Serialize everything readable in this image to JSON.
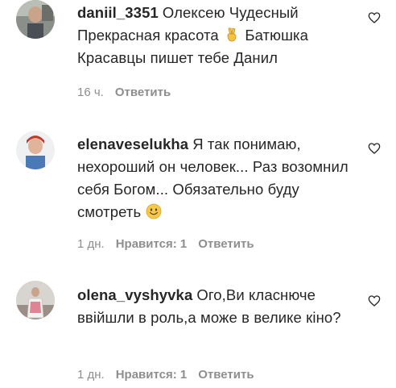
{
  "comments": [
    {
      "username": "daniil_3351",
      "text_before_emoji": "Олексею Чудесный Прекрасная красота",
      "emoji": "victory-hand",
      "text_after_emoji": "Батюшка Красавцы пишет тебе Данил",
      "time": "16 ч.",
      "likes": "",
      "reply": "Ответить"
    },
    {
      "username": "elenaveselukha",
      "text_before_emoji": "Я так понимаю, нехороший он человек... Раз возомнил себя Богом... Обязательно буду смотреть",
      "emoji": "smiling-face",
      "text_after_emoji": "",
      "time": "1 дн.",
      "likes": "Нравится: 1",
      "reply": "Ответить"
    },
    {
      "username": "olena_vyshyvka",
      "text_before_emoji": "Ого,Ви класнюче ввійшли в роль,а може в велике кіно?",
      "emoji": "",
      "text_after_emoji": "",
      "time": "1 дн.",
      "likes": "Нравится: 1",
      "reply": "Ответить"
    }
  ],
  "colors": {
    "text": "#262626",
    "secondary": "#8e8e8e",
    "background": "#ffffff"
  }
}
